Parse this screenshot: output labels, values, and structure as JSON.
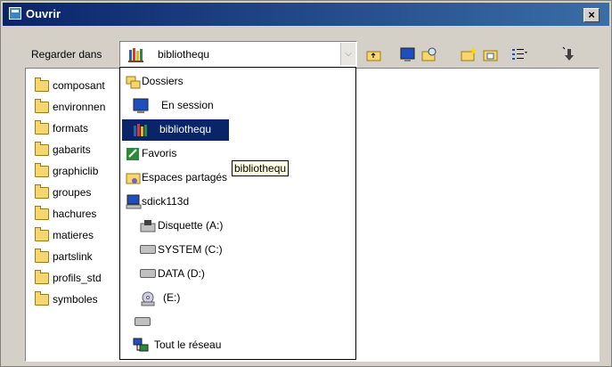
{
  "window": {
    "title": "Ouvrir",
    "close_symbol": "×"
  },
  "lookin": {
    "label": "Regarder dans",
    "value": "bibliothequ",
    "arrow": "⌵"
  },
  "toolbar": [
    "up-folder-icon",
    "desktop-icon",
    "search-folder-icon",
    "new-folder-icon",
    "folder-star-icon",
    "view-menu-icon",
    "tools-icon"
  ],
  "files": [
    "composant",
    "environnen",
    "formats",
    "gabarits",
    "graphiclib",
    "groupes",
    "hachures",
    "matieres",
    "partslink",
    "profils_std",
    "symboles"
  ],
  "dropdown": {
    "items": [
      {
        "label": "Dossiers",
        "icon": "folder-tree-icon",
        "indent": 0
      },
      {
        "label": "En session",
        "icon": "monitor-icon",
        "indent": 1
      },
      {
        "label": "bibliothequ",
        "icon": "library-icon",
        "indent": 1,
        "selected": true
      },
      {
        "label": "Favoris",
        "icon": "favorites-icon",
        "indent": 0
      },
      {
        "label": "Espaces partagés",
        "icon": "shared-folder-icon",
        "indent": 0
      },
      {
        "label": "sdick113d",
        "icon": "computer-icon",
        "indent": 0
      },
      {
        "label": "Disquette (A:)",
        "icon": "floppy-icon",
        "indent": 1
      },
      {
        "label": "SYSTEM (C:)",
        "icon": "drive-icon",
        "indent": 1
      },
      {
        "label": "DATA (D:)",
        "icon": "drive-icon",
        "indent": 1
      },
      {
        "label": "(E:)",
        "icon": "cd-drive-icon",
        "indent": 1
      },
      {
        "label": "",
        "icon": "drive-icon",
        "indent": 1
      },
      {
        "label": "Tout le réseau",
        "icon": "network-icon",
        "indent": 0
      }
    ]
  },
  "tooltip": "bibliothequ",
  "colors": {
    "title_start": "#0a246a",
    "title_end": "#3a6ea5",
    "selection": "#0a246a",
    "dialog": "#d4d0c8"
  }
}
